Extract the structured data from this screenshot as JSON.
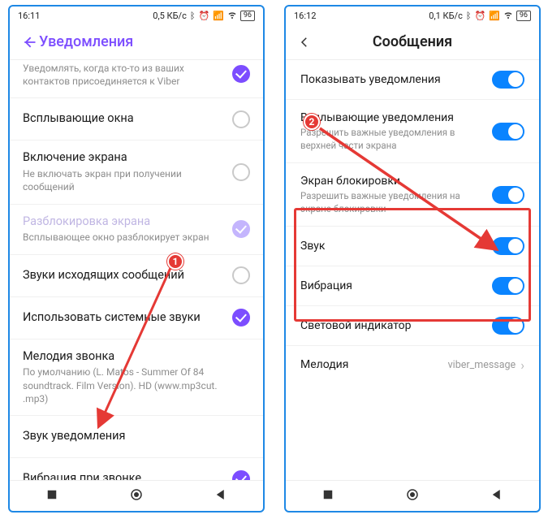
{
  "left": {
    "status": {
      "time": "16:11",
      "net": "0,5 КБ/с",
      "battery": "96"
    },
    "header": {
      "title": "Уведомления"
    },
    "rows": [
      {
        "title": "",
        "sub": "Уведомлять, когда кто-то из ваших контактов присоединяется к Viber",
        "control": "check-on"
      },
      {
        "title": "Всплывающие окна",
        "sub": "",
        "control": "check-off"
      },
      {
        "title": "Включение экрана",
        "sub": "Не включать экран при получении сообщений",
        "control": "check-off"
      },
      {
        "title": "Разблокировка экрана",
        "sub": "Всплывающее окно разблокирует экран",
        "control": "check-on-faded",
        "disabled": true
      },
      {
        "title": "Звуки исходящих сообщений",
        "sub": "",
        "control": "check-off"
      },
      {
        "title": "Использовать системные звуки",
        "sub": "",
        "control": "check-on"
      },
      {
        "title": "Мелодия звонка",
        "sub": "По умолчанию (L. Matos - Summer Of 84 soundtrack. Film Version). HD (www.mp3cut. .mp3)",
        "control": "none"
      },
      {
        "title": "Звук уведомления",
        "sub": "",
        "control": "none"
      },
      {
        "title": "Вибрация при звонке",
        "sub": "",
        "control": "check-on"
      }
    ]
  },
  "right": {
    "status": {
      "time": "16:12",
      "net": "0,1 КБ/с",
      "battery": "96"
    },
    "header": {
      "title": "Сообщения"
    },
    "rows": [
      {
        "title": "Показывать уведомления",
        "sub": "",
        "control": "toggle-on"
      },
      {
        "title": "Всплывающие уведомления",
        "sub": "Разрешить важные уведомления в верхней части экрана",
        "control": "toggle-on"
      },
      {
        "title": "Экран блокировки",
        "sub": "Разрешить важные уведомления на экране блокировки",
        "control": "toggle-on"
      },
      {
        "title": "Звук",
        "sub": "",
        "control": "toggle-on"
      },
      {
        "title": "Вибрация",
        "sub": "",
        "control": "toggle-on"
      },
      {
        "title": "Световой индикатор",
        "sub": "",
        "control": "toggle-on"
      },
      {
        "title": "Мелодия",
        "sub": "",
        "control": "value",
        "value": "viber_message"
      }
    ]
  },
  "anno": {
    "badge1": "1",
    "badge2": "2"
  }
}
